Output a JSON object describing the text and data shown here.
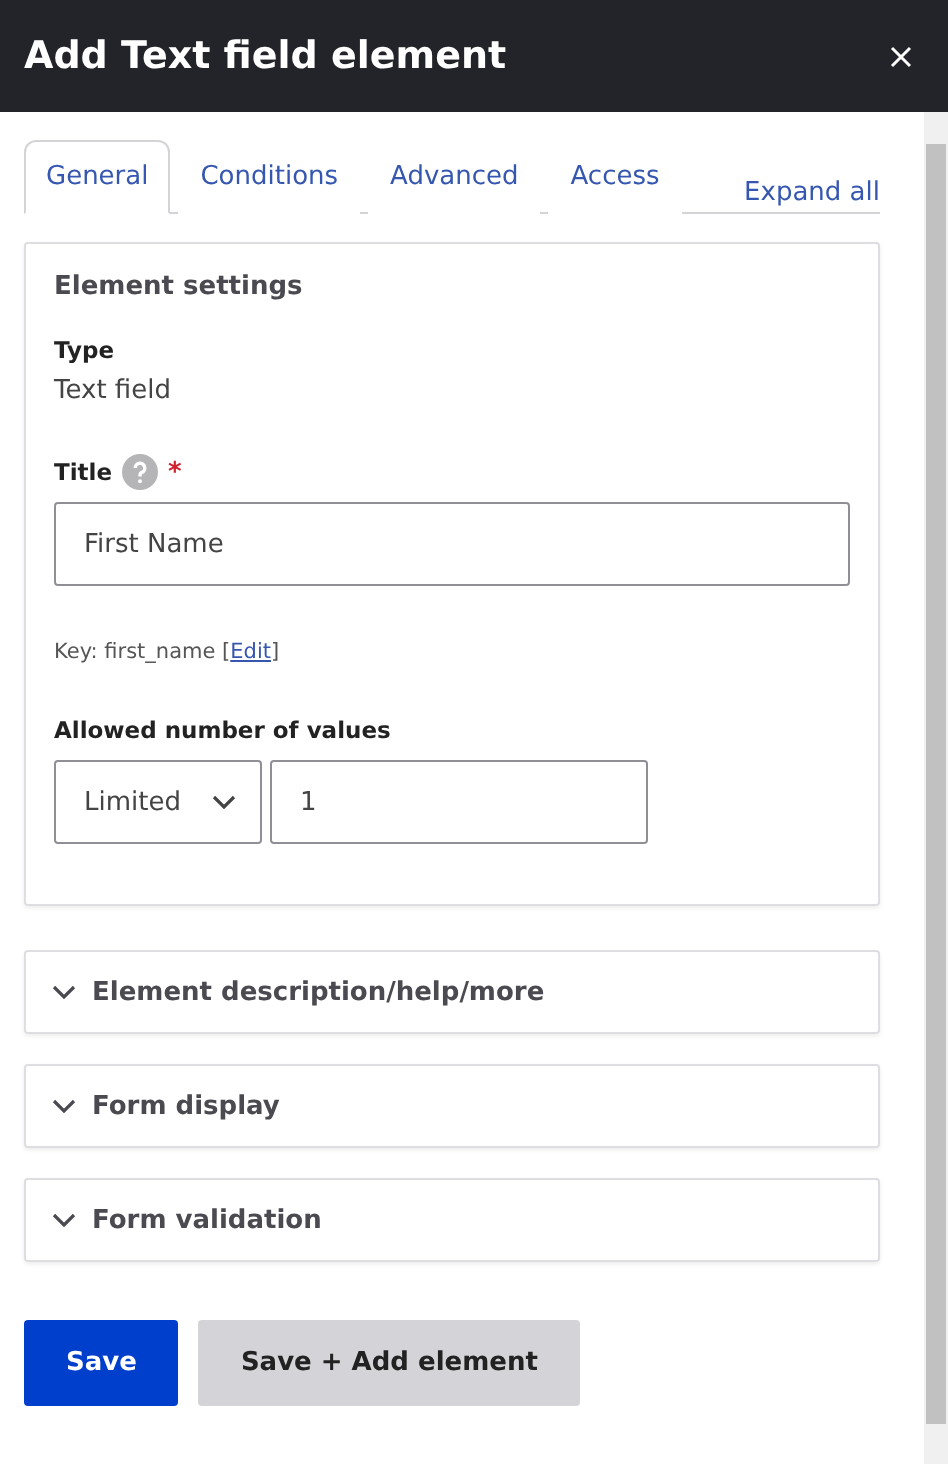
{
  "dialog": {
    "title": "Add Text field element"
  },
  "tabs": [
    {
      "label": "General",
      "selected": true
    },
    {
      "label": "Conditions",
      "selected": false
    },
    {
      "label": "Advanced",
      "selected": false
    },
    {
      "label": "Access",
      "selected": false
    }
  ],
  "expand_all": "Expand all",
  "settings": {
    "heading": "Element settings",
    "type_label": "Type",
    "type_value": "Text field",
    "title_label": "Title",
    "required_mark": "*",
    "title_value": "First Name",
    "key_hint": {
      "prefix": "Key: first_name [",
      "link": "Edit",
      "suffix": "]"
    },
    "allowed_label": "Allowed number of values",
    "allowed_select": "Limited",
    "allowed_count": "1"
  },
  "sections": [
    {
      "label": "Element description/help/more",
      "expanded": false
    },
    {
      "label": "Form display",
      "expanded": false
    },
    {
      "label": "Form validation",
      "expanded": false
    }
  ],
  "buttons": [
    {
      "label": "Save",
      "kind": "primary"
    },
    {
      "label": "Save + Add element",
      "kind": "secondary"
    }
  ]
}
